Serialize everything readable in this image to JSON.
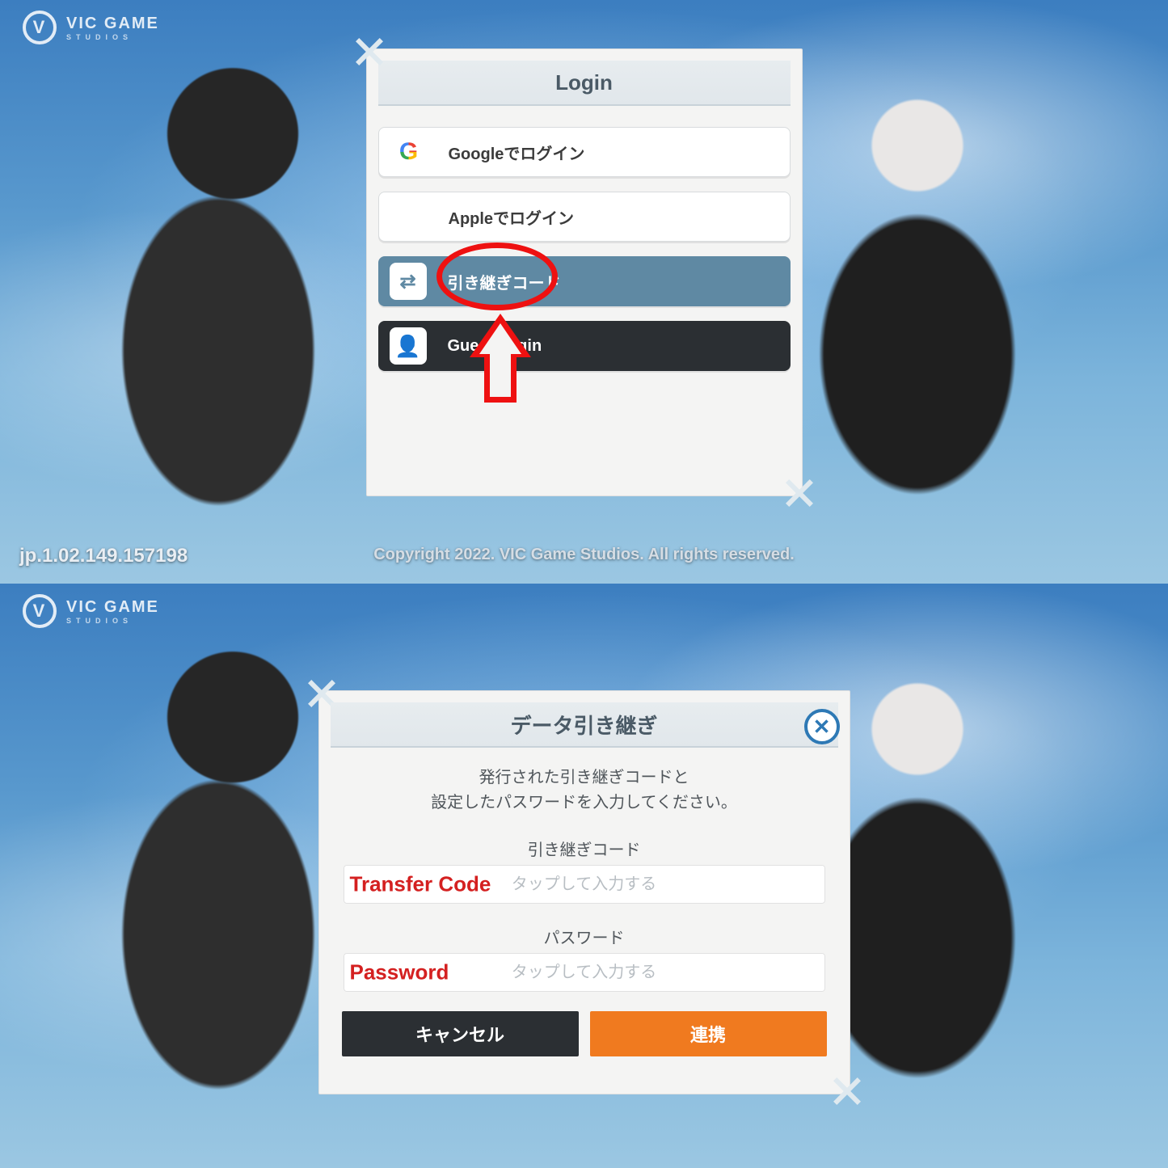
{
  "studio_logo": {
    "mark": "V",
    "line1": "VIC GAME",
    "line2": "STUDIOS"
  },
  "panel_top": {
    "version": "jp.1.02.149.157198",
    "copyright": "Copyright 2022. VIC Game Studios. All rights reserved.",
    "login_modal": {
      "title": "Login",
      "options": {
        "google": "Googleでログイン",
        "apple": "Appleでログイン",
        "transfer": "引き継ぎコード",
        "guest": "Guest Login"
      }
    }
  },
  "panel_bottom": {
    "transfer_modal": {
      "title": "データ引き継ぎ",
      "desc_line1": "発行された引き継ぎコードと",
      "desc_line2": "設定したパスワードを入力してください。",
      "field1_label": "引き継ぎコード",
      "field1_placeholder": "タップして入力する",
      "field1_annotation": "Transfer Code",
      "field2_label": "パスワード",
      "field2_placeholder": "タップして入力する",
      "field2_annotation": "Password",
      "cancel": "キャンセル",
      "link": "連携"
    }
  }
}
